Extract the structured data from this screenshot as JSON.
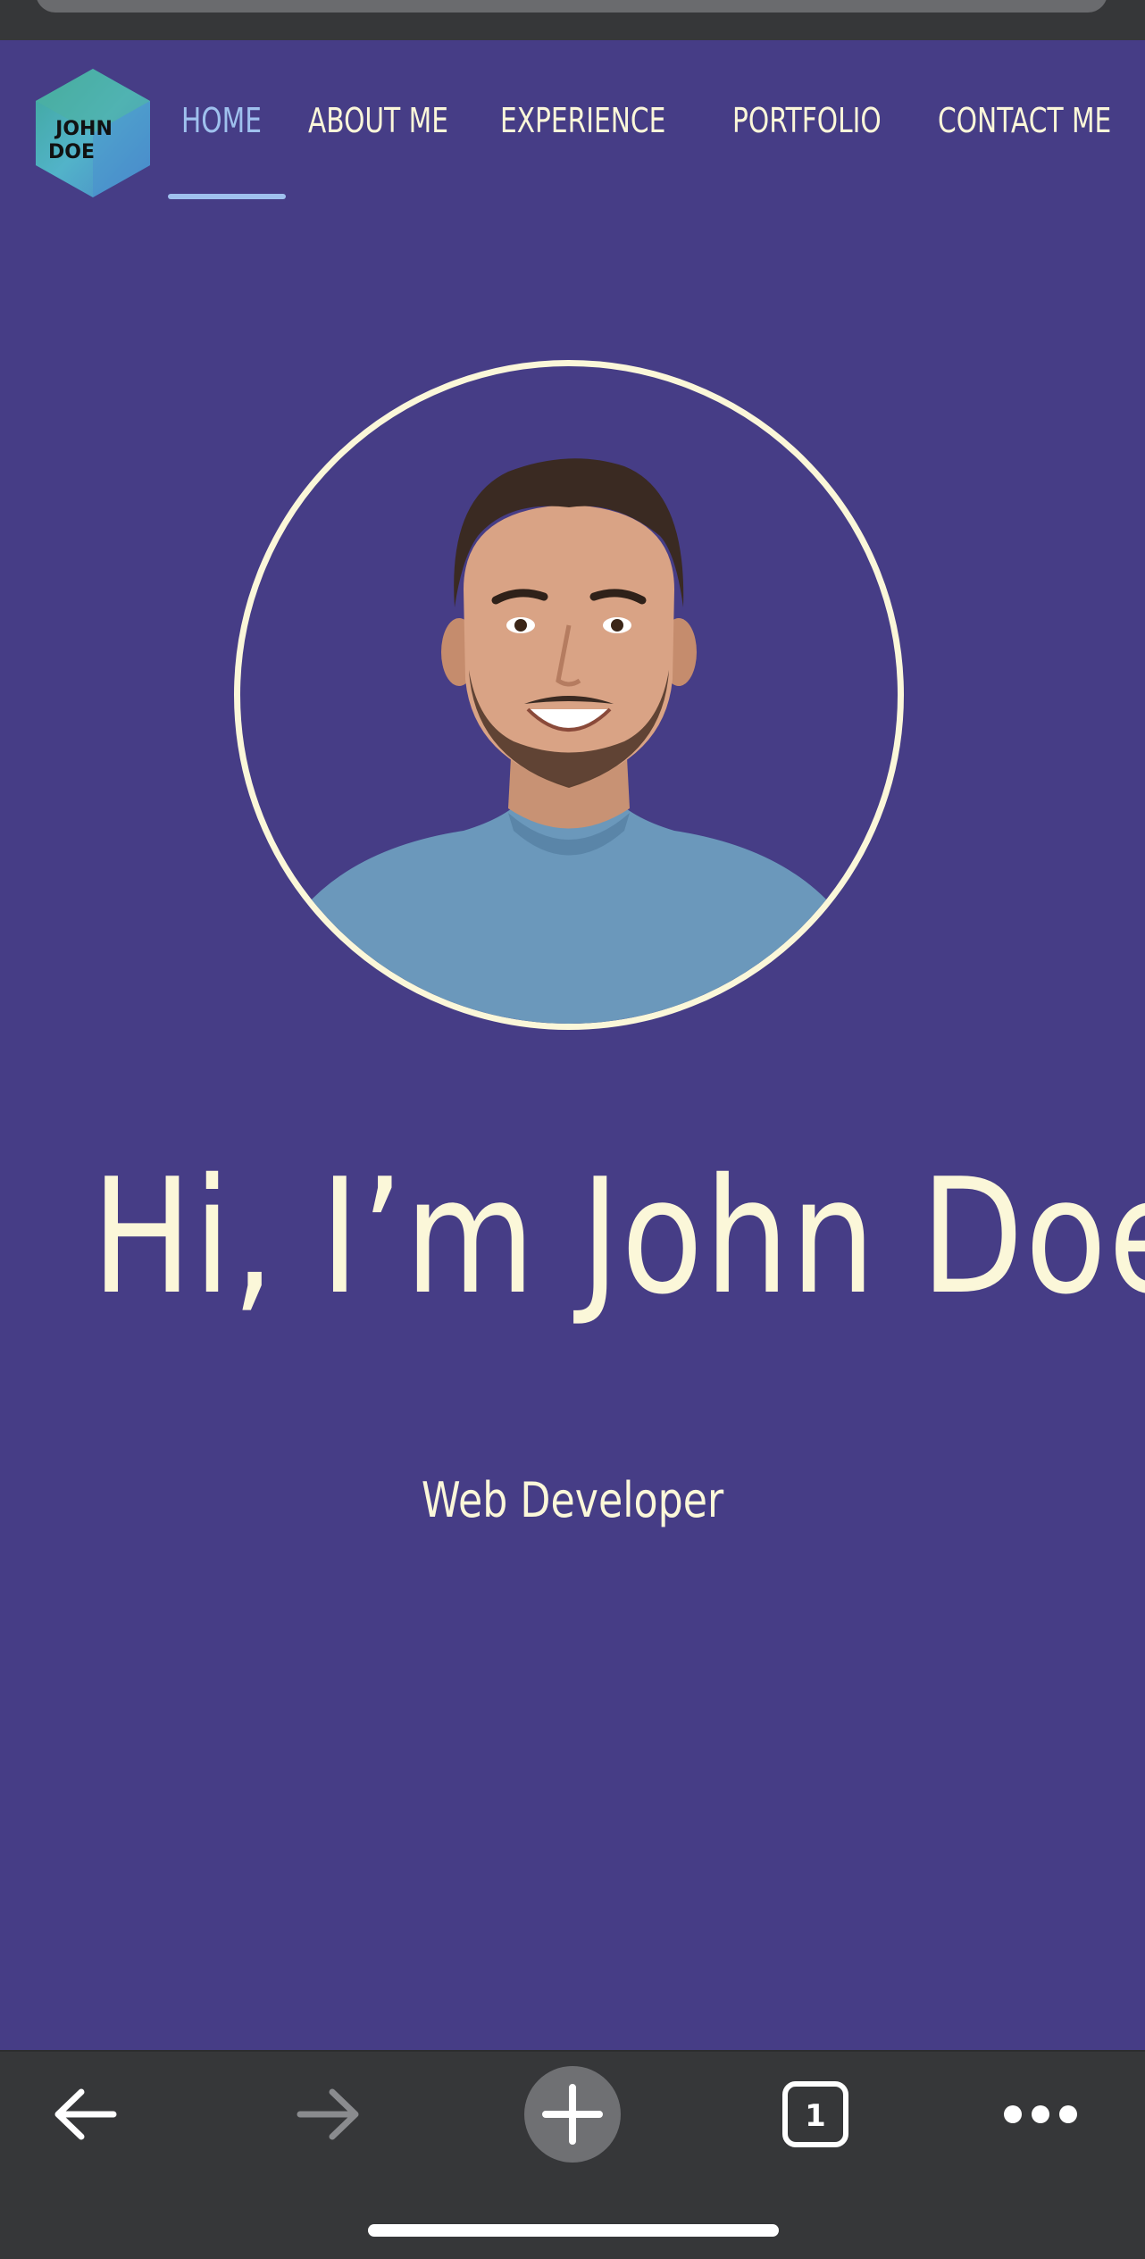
{
  "logo": {
    "line1": "JOHN",
    "line2": "DOE"
  },
  "nav": {
    "items": [
      {
        "label": "HOME",
        "active": true
      },
      {
        "label": "ABOUT ME",
        "active": false
      },
      {
        "label": "EXPERIENCE",
        "active": false
      },
      {
        "label": "PORTFOLIO",
        "active": false
      },
      {
        "label": "CONTACT ME",
        "active": false
      }
    ]
  },
  "hero": {
    "title": "Hi, I’m John Doe",
    "subtitle": "Web Developer"
  },
  "browser_toolbar": {
    "tab_count": "1",
    "buttons": [
      "back-icon",
      "forward-icon",
      "new-tab-icon",
      "tabs-icon",
      "more-icon"
    ]
  },
  "colors": {
    "page_background": "#463d86",
    "text_cream": "#fbf7d9",
    "nav_active": "#9fc1ee",
    "chrome_dark": "#363739"
  }
}
